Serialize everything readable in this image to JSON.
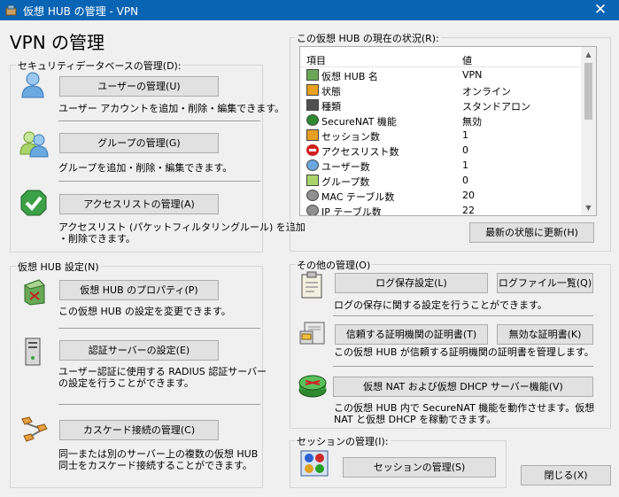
{
  "window": {
    "title": "仮想 HUB の管理 - VPN",
    "close_glyph": "✕"
  },
  "heading": "VPN の管理",
  "security_db": {
    "legend": "セキュリティデータベースの管理(D):",
    "users": {
      "button": "ユーザーの管理(U)",
      "desc": "ユーザー アカウントを追加・削除・編集できます。"
    },
    "groups": {
      "button": "グループの管理(G)",
      "desc": "グループを追加・削除・編集できます。"
    },
    "access": {
      "button": "アクセスリストの管理(A)",
      "desc1": "アクセスリスト (パケットフィルタリングルール) を追加",
      "desc2": "・削除できます。"
    }
  },
  "hub_settings": {
    "legend": "仮想 HUB 設定(N)",
    "properties": {
      "button": "仮想 HUB のプロパティ(P)",
      "desc": "この仮想 HUB の設定を変更できます。"
    },
    "auth": {
      "button": "認証サーバーの設定(E)",
      "desc1": "ユーザー認証に使用する RADIUS 認証サーバー",
      "desc2": "の設定を行うことができます。"
    },
    "cascade": {
      "button": "カスケード接続の管理(C)",
      "desc1": "同一または別のサーバー上の複数の仮想 HUB",
      "desc2": "同士をカスケード接続することができます。"
    }
  },
  "status": {
    "legend": "この仮想 HUB の現在の状況(R):",
    "columns": [
      "項目",
      "値"
    ],
    "rows": [
      {
        "item": "仮想 HUB 名",
        "value": "VPN",
        "icon": "hub-icon"
      },
      {
        "item": "状態",
        "value": "オンライン",
        "icon": "status-icon"
      },
      {
        "item": "種類",
        "value": "スタンドアロン",
        "icon": "server-icon"
      },
      {
        "item": "SecureNAT 機能",
        "value": "無効",
        "icon": "securenat-icon"
      },
      {
        "item": "セッション数",
        "value": "1",
        "icon": "session-icon"
      },
      {
        "item": "アクセスリスト数",
        "value": "0",
        "icon": "no-entry-icon"
      },
      {
        "item": "ユーザー数",
        "value": "1",
        "icon": "user-icon"
      },
      {
        "item": "グループ数",
        "value": "0",
        "icon": "group-icon"
      },
      {
        "item": "MAC テーブル数",
        "value": "20",
        "icon": "gear-icon"
      },
      {
        "item": "IP テーブル数",
        "value": "22",
        "icon": "gear-icon"
      }
    ],
    "refresh_button": "最新の状態に更新(H)"
  },
  "other": {
    "legend": "その他の管理(O)",
    "log_settings": "ログ保存設定(L)",
    "log_files": "ログファイル一覧(Q)",
    "log_desc": "ログの保存に関する設定を行うことができます。",
    "trusted_ca": "信頼する証明機関の証明書(T)",
    "invalid_cert": "無効な証明書(K)",
    "cert_desc": "この仮想 HUB が信頼する証明機関の証明書を管理します。",
    "nat_dhcp": "仮想 NAT および仮想 DHCP サーバー機能(V)",
    "nat_desc1": "この仮想 HUB 内で SecureNAT 機能を動作させます。仮想",
    "nat_desc2": "NAT と仮想 DHCP を稼動できます。"
  },
  "session": {
    "legend": "セッションの管理(I):",
    "button": "セッションの管理(S)"
  },
  "close_button": "閉じる(X)"
}
